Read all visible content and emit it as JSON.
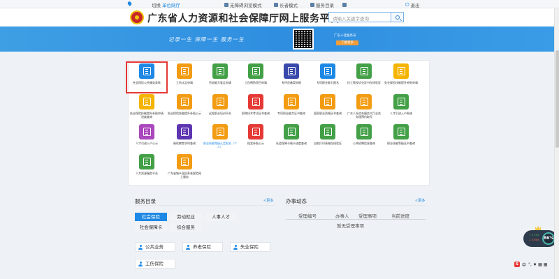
{
  "topbar": {
    "switch_label": "切换",
    "location": "单位网厅",
    "barrier_free": "无障碍浏览模式",
    "elder_mode": "长者模式",
    "service_dir": "服务目录",
    "logout": "退出"
  },
  "header": {
    "title": "广东省人力资源和社会保障厅网上服务平台",
    "search_placeholder": "请输入关键字查询"
  },
  "banner": {
    "slogan": "记录一生  保障一生  服务一生",
    "follow_text": "广东人社服务号",
    "more_label": "了解更多"
  },
  "services": [
    {
      "label": "社会保险公共服务条款",
      "color": "#1e88e5",
      "selected": true
    },
    {
      "label": "工伤认定申请",
      "color": "#f39c12"
    },
    {
      "label": "劳动能力鉴定申请",
      "color": "#43a047"
    },
    {
      "label": "工伤预防项目申请",
      "color": "#43a047"
    },
    {
      "label": "考评员备案申报",
      "color": "#3949ab"
    },
    {
      "label": "专项职业能力报名",
      "color": "#1e88e5"
    },
    {
      "label": "技工院校毕业证书在线验证",
      "color": "#43a047"
    },
    {
      "label": "失业保险技能提升补贴申请",
      "color": "#f5b400"
    },
    {
      "label": "失业保险技能提升补贴申请进度查询",
      "color": "#f5b400"
    },
    {
      "label": "失业保险技能提升补贴公示",
      "color": "#f39c12"
    },
    {
      "label": "远程职业培训平台",
      "color": "#f39c12"
    },
    {
      "label": "职称技术考试证书查询",
      "color": "#e53935"
    },
    {
      "label": "专项职业能力证书查询",
      "color": "#f39c12"
    },
    {
      "label": "国家职业资格证书查询",
      "color": "#f39c12"
    },
    {
      "label": "广东人社综合服务大厅业务办理预约取号",
      "color": "#f39c12"
    },
    {
      "label": "人才引进入户系统",
      "color": "#43a047"
    },
    {
      "label": "人才引进入户公示",
      "color": "#ab47bc"
    },
    {
      "label": "继续教育学时查询",
      "color": "#5e35b1"
    },
    {
      "label": "职业技能等级认定报名（个人）",
      "color": "#f39c12",
      "blue_label": true
    },
    {
      "label": "档案补贴公示",
      "color": "#e53935"
    },
    {
      "label": "社会保障卡制卡进度查询",
      "color": "#43a047"
    },
    {
      "label": "自助打印表格在线验证",
      "color": "#43a047"
    },
    {
      "label": "公共招聘信息查询",
      "color": "#43a047"
    },
    {
      "label": "职业技能等级证书查询",
      "color": "#43a047"
    },
    {
      "label": "人力资源服务平台",
      "color": "#43a047"
    },
    {
      "label": "广东省城乡居民养老保险网上服务",
      "color": "#f39c12"
    }
  ],
  "directory": {
    "title": "服务目录",
    "more": "<更多",
    "tabs": [
      "社会保险",
      "劳动就业",
      "人事人才",
      "社会保障卡",
      "综合服务"
    ],
    "chips": [
      "公共业务",
      "养老保险",
      "失业保险",
      "工伤保险"
    ]
  },
  "affairs": {
    "title": "办事动态",
    "more": "<更多",
    "columns": [
      "受理编号",
      "办事人",
      "受理事项",
      "当前进度"
    ],
    "empty": "暂无受理事项"
  },
  "widget": {
    "up_rate": "↑ 0.2k/s",
    "down_rate": "↓ 0.6k/s",
    "percent": "86%"
  },
  "ime": {
    "logo": "S",
    "mode": "中",
    "symbols": "°, ♦ ▦ ▦"
  }
}
